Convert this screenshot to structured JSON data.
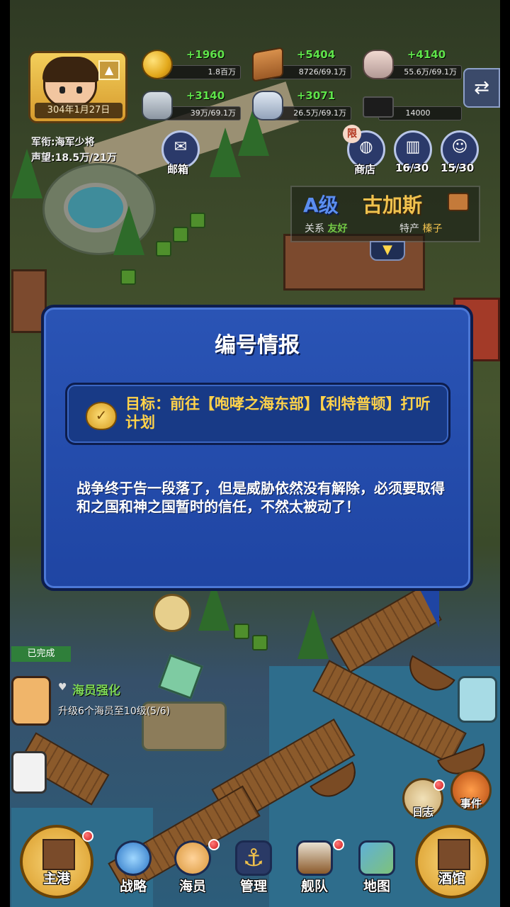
{
  "player": {
    "date": "304年1月27日",
    "rank_label": "军衔:海军少将",
    "fame_label": "声望:18.5万/21万"
  },
  "resources": [
    {
      "name": "coin",
      "gain": "+1960",
      "amount": "1.8百万"
    },
    {
      "name": "wood",
      "gain": "+5404",
      "amount": "8726/69.1万"
    },
    {
      "name": "stone",
      "gain": "+4140",
      "amount": "55.6万/69.1万"
    },
    {
      "name": "iron",
      "gain": "+3140",
      "amount": "39万/69.1万"
    },
    {
      "name": "gem",
      "gain": "+3071",
      "amount": "26.5万/69.1万"
    },
    {
      "name": "cap",
      "gain": "",
      "amount": "14000"
    }
  ],
  "top_buttons": {
    "mail": "邮箱",
    "shop": "商店",
    "shop_tag": "限",
    "book_count": "16/30",
    "crew_count": "15/30"
  },
  "city": {
    "grade": "A级",
    "name": "古加斯",
    "relation_label": "关系",
    "relation_value": "友好",
    "product_label": "特产",
    "product_value": "榛子"
  },
  "dialog": {
    "title": "编号情报",
    "goal": "目标：前往【咆哮之海东部】【利特普顿】打听计划",
    "body": "战争终于告一段落了，但是威胁依然没有解除，必须要取得和之国和神之国暂时的信任，不然太被动了！"
  },
  "task": {
    "done_label": "已完成",
    "title": "海员强化",
    "desc": "升级6个海员至10级(5/6)"
  },
  "side_buttons": {
    "log": "日志",
    "event": "事件"
  },
  "nav": {
    "home": "主港",
    "strategy": "战略",
    "crew": "海员",
    "manage": "管理",
    "fleet": "舰队",
    "map": "地图",
    "tavern": "酒馆"
  },
  "colors": {
    "dialog_bg": "#2a54b5",
    "goal_text": "#ffd24a",
    "gain_green": "#5fe34a"
  }
}
